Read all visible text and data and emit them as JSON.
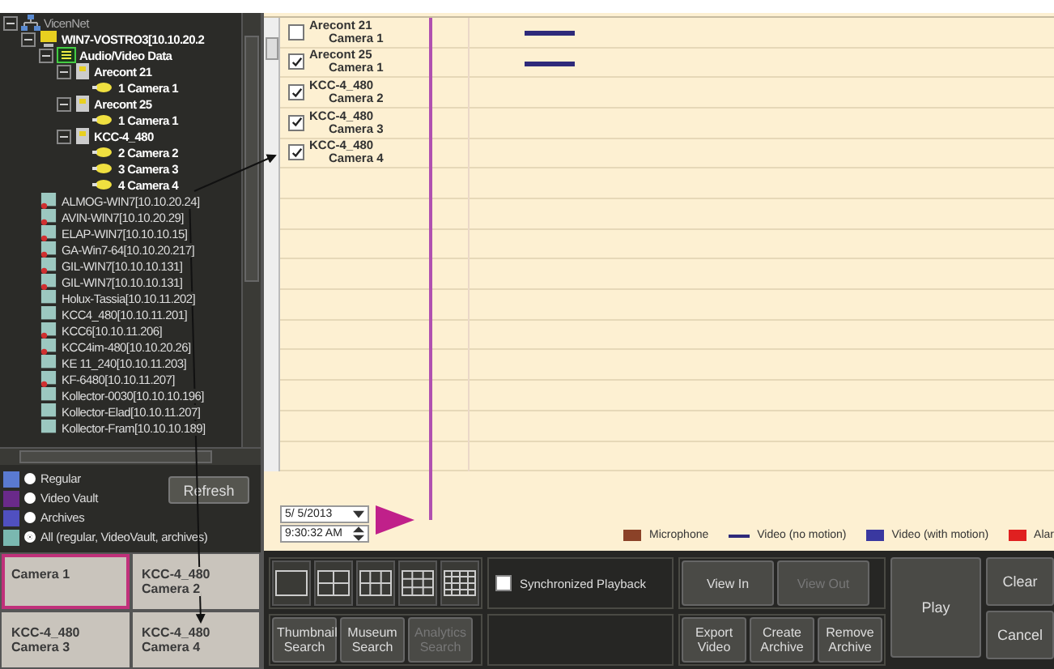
{
  "tree": {
    "label": "VicenNet",
    "kind": "network",
    "expanded": true,
    "children": [
      {
        "label": "WIN7-VOSTRO3[10.10.20.2",
        "kind": "server",
        "expanded": true,
        "children": [
          {
            "label": "Audio/Video Data",
            "kind": "data",
            "expanded": true,
            "children": [
              {
                "label": "Arecont 21",
                "kind": "device",
                "expanded": true,
                "children": [
                  {
                    "label": "1  Camera 1",
                    "kind": "camera"
                  }
                ]
              },
              {
                "label": "Arecont 25",
                "kind": "device",
                "expanded": true,
                "children": [
                  {
                    "label": "1  Camera 1",
                    "kind": "camera"
                  }
                ]
              },
              {
                "label": "KCC-4_480",
                "kind": "device",
                "expanded": true,
                "children": [
                  {
                    "label": "2  Camera 2",
                    "kind": "camera"
                  },
                  {
                    "label": "3  Camera 3",
                    "kind": "camera"
                  },
                  {
                    "label": "4  Camera 4",
                    "kind": "camera"
                  }
                ]
              }
            ]
          }
        ]
      },
      {
        "label": "ALMOG-WIN7[10.10.20.24]",
        "kind": "host",
        "alert": true
      },
      {
        "label": "AVIN-WIN7[10.10.20.29]",
        "kind": "host",
        "alert": true
      },
      {
        "label": "ELAP-WIN7[10.10.10.15]",
        "kind": "host",
        "alert": true
      },
      {
        "label": "GA-Win7-64[10.10.20.217]",
        "kind": "host",
        "alert": true
      },
      {
        "label": "GIL-WIN7[10.10.10.131]",
        "kind": "host",
        "alert": true
      },
      {
        "label": "GIL-WIN7[10.10.10.131]",
        "kind": "host",
        "alert": true
      },
      {
        "label": "Holux-Tassia[10.10.11.202]",
        "kind": "host",
        "alert": false
      },
      {
        "label": "KCC4_480[10.10.11.201]",
        "kind": "host",
        "alert": false
      },
      {
        "label": "KCC6[10.10.11.206]",
        "kind": "host",
        "alert": true
      },
      {
        "label": "KCC4im-480[10.10.20.26]",
        "kind": "host",
        "alert": true
      },
      {
        "label": "KE 11_240[10.10.11.203]",
        "kind": "host",
        "alert": false
      },
      {
        "label": "KF-6480[10.10.11.207]",
        "kind": "host",
        "alert": true
      },
      {
        "label": "Kollector-0030[10.10.10.196]",
        "kind": "host",
        "alert": false
      },
      {
        "label": "Kollector-Elad[10.10.11.207]",
        "kind": "host",
        "alert": false
      },
      {
        "label": "Kollector-Fram[10.10.10.189]",
        "kind": "host",
        "alert": false
      }
    ]
  },
  "source_filter": {
    "options": [
      {
        "label": "Regular",
        "kind": "regular",
        "selected": false
      },
      {
        "label": "Video Vault",
        "kind": "vault",
        "selected": false
      },
      {
        "label": "Archives",
        "kind": "archive",
        "selected": false
      },
      {
        "label": "All (regular, VideoVault, archives)",
        "kind": "all",
        "selected": true
      }
    ],
    "refresh_button": "Refresh"
  },
  "camera_grid": [
    {
      "camera": "Camera 1",
      "selected": true
    },
    {
      "device": "KCC-4_480",
      "camera": "Camera 2",
      "selected": false
    },
    {
      "device": "KCC-4_480",
      "camera": "Camera 3",
      "selected": false
    },
    {
      "device": "KCC-4_480",
      "camera": "Camera 4",
      "selected": false
    }
  ],
  "timeline": {
    "rows": [
      {
        "device": "Arecont 21",
        "camera": "Camera 1",
        "checked": false,
        "video": true
      },
      {
        "device": "Arecont 25",
        "camera": "Camera 1",
        "checked": true,
        "video": true
      },
      {
        "device": "KCC-4_480",
        "camera": "Camera 2",
        "checked": true,
        "video": false
      },
      {
        "device": "KCC-4_480",
        "camera": "Camera 3",
        "checked": true,
        "video": false
      },
      {
        "device": "KCC-4_480",
        "camera": "Camera 4",
        "checked": true,
        "video": false
      }
    ],
    "date": "5/ 5/2013",
    "time": "9:30:32 AM",
    "legend": [
      {
        "label": "Microphone",
        "kind": "square",
        "color": "#8b4228"
      },
      {
        "label": "Video (no motion)",
        "kind": "line",
        "color": "#2e2a7a"
      },
      {
        "label": "Video (with motion)",
        "kind": "square",
        "color": "#3a38a0"
      },
      {
        "label": "Alar",
        "kind": "square",
        "color": "#e02020"
      }
    ]
  },
  "toolbar": {
    "layouts": [
      {
        "kind": "single"
      },
      {
        "kind": "quad"
      },
      {
        "kind": "six"
      },
      {
        "kind": "nine"
      },
      {
        "kind": "sixteen"
      }
    ],
    "search_buttons": [
      {
        "label": "Thumbnail Search",
        "disabled": false
      },
      {
        "label": "Museum Search",
        "disabled": false
      },
      {
        "label": "Analytics Search",
        "disabled": true
      }
    ],
    "sync_playback": {
      "label": "Synchronized Playback",
      "checked": false
    },
    "view_buttons": [
      {
        "label": "View In",
        "disabled": false
      },
      {
        "label": "View Out",
        "disabled": true
      }
    ],
    "export_button": "Export Video",
    "archive_buttons": [
      {
        "label": "Create Archive",
        "disabled": false
      },
      {
        "label": "Remove Archive",
        "disabled": false
      }
    ],
    "play_button": "Play",
    "clear_button": "Clear",
    "cancel_button": "Cancel"
  }
}
